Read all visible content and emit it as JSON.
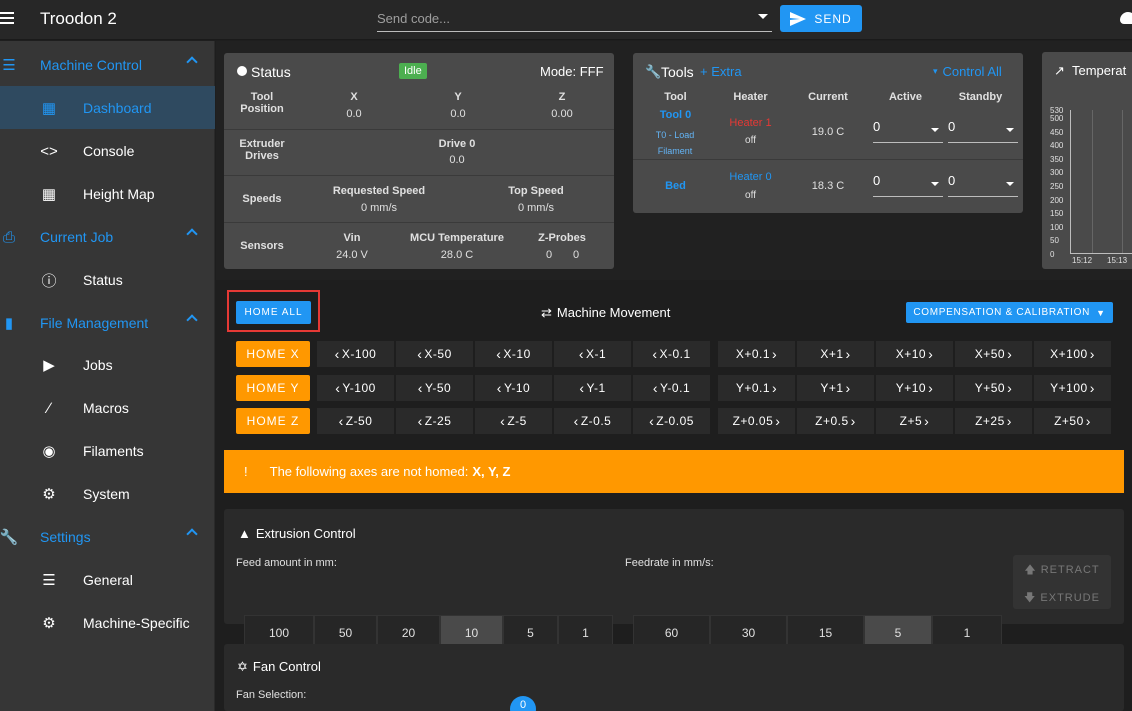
{
  "app": {
    "title": "Troodon 2"
  },
  "topbar": {
    "code_placeholder": "Send code...",
    "send_label": "SEND"
  },
  "sidebar": {
    "groups": [
      {
        "label": "Machine Control",
        "icon": "sliders-icon"
      },
      {
        "label": "Current Job",
        "icon": "printer-icon"
      },
      {
        "label": "File Management",
        "icon": "sd-card-icon"
      },
      {
        "label": "Settings",
        "icon": "wrench-icon"
      }
    ],
    "items": {
      "dashboard": "Dashboard",
      "console": "Console",
      "heightmap": "Height Map",
      "status": "Status",
      "jobs": "Jobs",
      "macros": "Macros",
      "filaments": "Filaments",
      "system": "System",
      "general": "General",
      "machine_specific": "Machine-Specific"
    }
  },
  "status": {
    "title": "Status",
    "state": "Idle",
    "mode": "Mode: FFF",
    "tool_position_label": "Tool Position",
    "axes": [
      {
        "name": "X",
        "value": "0.0"
      },
      {
        "name": "Y",
        "value": "0.0"
      },
      {
        "name": "Z",
        "value": "0.00"
      }
    ],
    "extruder_label": "Extruder Drives",
    "drive_name": "Drive 0",
    "drive_value": "0.0",
    "speeds_label": "Speeds",
    "requested_speed_label": "Requested Speed",
    "requested_speed": "0 mm/s",
    "top_speed_label": "Top Speed",
    "top_speed": "0 mm/s",
    "sensors_label": "Sensors",
    "vin_label": "Vin",
    "vin": "24.0 V",
    "mcu_label": "MCU Temperature",
    "mcu": "28.0 C",
    "zprobes_label": "Z-Probes",
    "zprobe_a": "0",
    "zprobe_b": "0"
  },
  "tools": {
    "title": "Tools",
    "extra": "+ Extra",
    "control_all": "Control All",
    "headers": {
      "tool": "Tool",
      "heater": "Heater",
      "current": "Current",
      "active": "Active",
      "standby": "Standby"
    },
    "rows": [
      {
        "tool": "Tool 0",
        "sub": "T0 - Load Filament",
        "heater": "Heater 1",
        "heater_state": "off",
        "current": "19.0 C",
        "active": "0",
        "standby": "0"
      },
      {
        "tool": "Bed",
        "sub": "",
        "heater": "Heater 0",
        "heater_state": "off",
        "current": "18.3 C",
        "active": "0",
        "standby": "0"
      }
    ]
  },
  "temperature": {
    "title": "Temperat",
    "y_ticks": [
      "530",
      "500",
      "450",
      "400",
      "350",
      "300",
      "250",
      "200",
      "150",
      "100",
      "50",
      "0"
    ],
    "x_ticks": [
      "15:12",
      "15:13"
    ]
  },
  "movement": {
    "home_all": "HOME ALL",
    "title": "Machine Movement",
    "compensation": "COMPENSATION & CALIBRATION",
    "rows": [
      {
        "home": "HOME X",
        "minus": [
          "X-100",
          "X-50",
          "X-10",
          "X-1",
          "X-0.1"
        ],
        "plus": [
          "X+0.1",
          "X+1",
          "X+10",
          "X+50",
          "X+100"
        ]
      },
      {
        "home": "HOME Y",
        "minus": [
          "Y-100",
          "Y-50",
          "Y-10",
          "Y-1",
          "Y-0.1"
        ],
        "plus": [
          "Y+0.1",
          "Y+1",
          "Y+10",
          "Y+50",
          "Y+100"
        ]
      },
      {
        "home": "HOME Z",
        "minus": [
          "Z-50",
          "Z-25",
          "Z-5",
          "Z-0.5",
          "Z-0.05"
        ],
        "plus": [
          "Z+0.05",
          "Z+0.5",
          "Z+5",
          "Z+25",
          "Z+50"
        ]
      }
    ],
    "warning_prefix": "The following axes are not homed: ",
    "warning_axes": "X, Y, Z"
  },
  "extrusion": {
    "title": "Extrusion Control",
    "feed_label": "Feed amount in mm:",
    "feed_values": [
      "100",
      "50",
      "20",
      "10",
      "5",
      "1"
    ],
    "feed_selected": "10",
    "rate_label": "Feedrate in mm/s:",
    "rate_values": [
      "60",
      "30",
      "15",
      "5",
      "1"
    ],
    "rate_selected": "5",
    "retract": "RETRACT",
    "extrude": "EXTRUDE"
  },
  "fan": {
    "title": "Fan Control",
    "selection_label": "Fan Selection:",
    "badge": "0"
  },
  "colors": {
    "accent": "#2196f3",
    "warning": "#ff9800",
    "success": "#4caf50",
    "danger": "#e53935"
  }
}
